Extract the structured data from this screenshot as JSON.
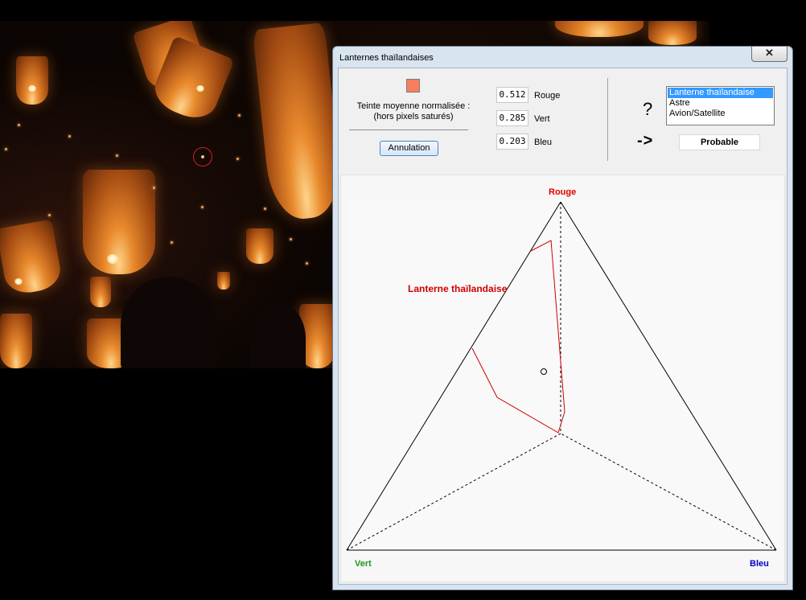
{
  "window": {
    "title": "Lanternes thaïlandaises",
    "close_glyph": "✕"
  },
  "swatch_color": "#f87f5e",
  "hue_label": {
    "line1": "Teinte moyenne normalisée :",
    "line2": "(hors pixels saturés)"
  },
  "cancel_button": "Annulation",
  "values": [
    {
      "value": "0.512",
      "label": "Rouge"
    },
    {
      "value": "0.285",
      "label": "Vert"
    },
    {
      "value": "0.203",
      "label": "Bleu"
    }
  ],
  "question_mark": "?",
  "arrow": "->",
  "class_list": {
    "items": [
      "Lanterne thaïlandaise",
      "Astre",
      "Avion/Satellite"
    ],
    "selected_index": 0
  },
  "result": "Probable",
  "diagram": {
    "vertex_labels": {
      "top": "Rouge",
      "left": "Vert",
      "right": "Bleu"
    },
    "region_label": "Lanterne thaïlandaise",
    "colors": {
      "rouge": "#e00000",
      "vert": "#1a9a1a",
      "bleu": "#0000cc",
      "region": "#d00000"
    }
  }
}
